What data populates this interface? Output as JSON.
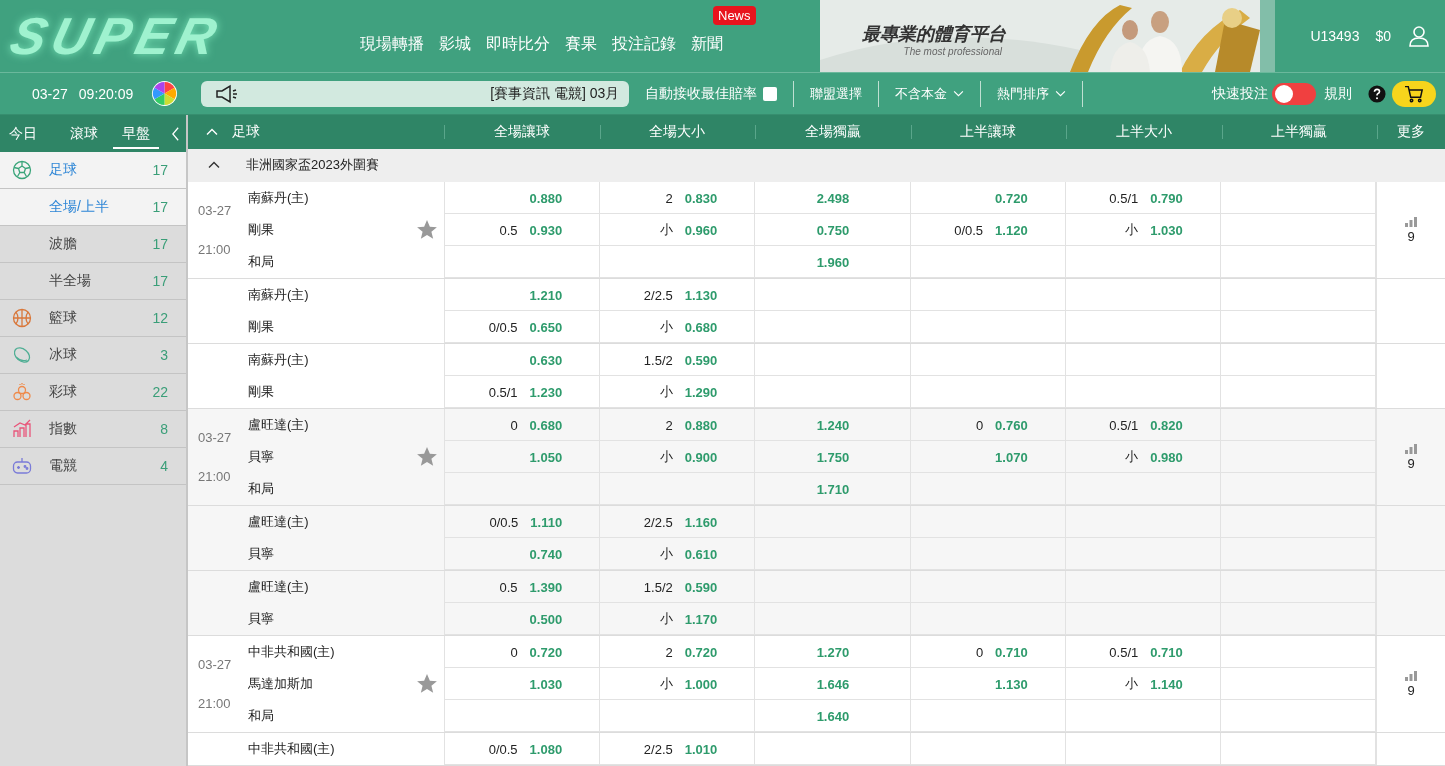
{
  "header": {
    "logo": "SUPER",
    "nav": [
      {
        "label": "現場轉播"
      },
      {
        "label": "影城"
      },
      {
        "label": "即時比分"
      },
      {
        "label": "賽果"
      },
      {
        "label": "投注記錄"
      },
      {
        "label": "新聞",
        "badge": "News"
      }
    ]
  },
  "banner": {
    "kind": "picture",
    "title": "最專業的體育平台",
    "subtitle": "The most professional"
  },
  "account": {
    "user": "U13493",
    "balance": "$0"
  },
  "toolbar": {
    "date": "03-27",
    "time": "09:20:09",
    "marquee": "[賽事資訊 電競] 03月",
    "auto_accept": {
      "label": "自動接收最佳賠率",
      "checked": false
    },
    "filters": [
      {
        "label": "聯盟選擇",
        "dropdown": false
      },
      {
        "label": "不含本金",
        "dropdown": true
      },
      {
        "label": "熱門排序",
        "dropdown": true
      }
    ],
    "quick_bet": {
      "label": "快速投注",
      "on": false
    },
    "rules": "規則"
  },
  "sidebar": {
    "tabs": [
      {
        "label": "今日",
        "selected": false
      },
      {
        "label": "滾球",
        "selected": false
      },
      {
        "label": "早盤",
        "selected": true
      }
    ],
    "items": [
      {
        "label": "足球",
        "count": "17",
        "selected": true,
        "children": [
          {
            "label": "全場/上半",
            "count": "17",
            "selected": true
          },
          {
            "label": "波膽",
            "count": "17",
            "selected": false
          },
          {
            "label": "半全場",
            "count": "17",
            "selected": false
          }
        ]
      },
      {
        "label": "籃球",
        "count": "12",
        "selected": false
      },
      {
        "label": "冰球",
        "count": "3",
        "selected": false
      },
      {
        "label": "彩球",
        "count": "22",
        "selected": false
      },
      {
        "label": "指數",
        "count": "8",
        "selected": false
      },
      {
        "label": "電競",
        "count": "4",
        "selected": false
      }
    ]
  },
  "table": {
    "sport": "足球",
    "expanded": true,
    "columns": [
      {
        "label": "全場讓球",
        "kind": "handicap"
      },
      {
        "label": "全場大小",
        "kind": "handicap"
      },
      {
        "label": "全場獨贏",
        "kind": "moneyline"
      },
      {
        "label": "上半讓球",
        "kind": "handicap"
      },
      {
        "label": "上半大小",
        "kind": "handicap"
      },
      {
        "label": "上半獨贏",
        "kind": "moneyline"
      }
    ],
    "more": "更多",
    "league": {
      "name": "非洲國家盃2023外圍賽",
      "expanded": true
    },
    "matches": [
      {
        "date": "03-27",
        "time": "21:00",
        "favorite": false,
        "more": "9",
        "rows": [
          {
            "team": "南蘇丹(主)",
            "cells": [
              {
                "odds": "0.880"
              },
              {
                "line": "2",
                "odds": "0.830"
              },
              {
                "odds": "2.498"
              },
              {
                "odds": "0.720"
              },
              {
                "line": "0.5/1",
                "odds": "0.790"
              },
              null
            ]
          },
          {
            "team": "剛果",
            "cells": [
              {
                "line": "0.5",
                "odds": "0.930"
              },
              {
                "line": "小",
                "odds": "0.960"
              },
              {
                "odds": "0.750"
              },
              {
                "line": "0/0.5",
                "odds": "1.120"
              },
              {
                "line": "小",
                "odds": "1.030"
              },
              null
            ]
          },
          {
            "team": "和局",
            "cells": [
              null,
              null,
              {
                "odds": "1.960"
              },
              null,
              null,
              null
            ]
          }
        ],
        "alt_lines": [
          {
            "rows": [
              {
                "team": "南蘇丹(主)",
                "cells": [
                  {
                    "odds": "1.210"
                  },
                  {
                    "line": "2/2.5",
                    "odds": "1.130"
                  }
                ]
              },
              {
                "team": "剛果",
                "cells": [
                  {
                    "line": "0/0.5",
                    "odds": "0.650"
                  },
                  {
                    "line": "小",
                    "odds": "0.680"
                  }
                ]
              }
            ]
          },
          {
            "rows": [
              {
                "team": "南蘇丹(主)",
                "cells": [
                  {
                    "odds": "0.630"
                  },
                  {
                    "line": "1.5/2",
                    "odds": "0.590"
                  }
                ]
              },
              {
                "team": "剛果",
                "cells": [
                  {
                    "line": "0.5/1",
                    "odds": "1.230"
                  },
                  {
                    "line": "小",
                    "odds": "1.290"
                  }
                ]
              }
            ]
          }
        ]
      },
      {
        "date": "03-27",
        "time": "21:00",
        "favorite": false,
        "more": "9",
        "rows": [
          {
            "team": "盧旺達(主)",
            "cells": [
              {
                "line": "0",
                "odds": "0.680"
              },
              {
                "line": "2",
                "odds": "0.880"
              },
              {
                "odds": "1.240"
              },
              {
                "line": "0",
                "odds": "0.760"
              },
              {
                "line": "0.5/1",
                "odds": "0.820"
              },
              null
            ]
          },
          {
            "team": "貝寧",
            "cells": [
              {
                "odds": "1.050"
              },
              {
                "line": "小",
                "odds": "0.900"
              },
              {
                "odds": "1.750"
              },
              {
                "odds": "1.070"
              },
              {
                "line": "小",
                "odds": "0.980"
              },
              null
            ]
          },
          {
            "team": "和局",
            "cells": [
              null,
              null,
              {
                "odds": "1.710"
              },
              null,
              null,
              null
            ]
          }
        ],
        "alt_lines": [
          {
            "rows": [
              {
                "team": "盧旺達(主)",
                "cells": [
                  {
                    "line": "0/0.5",
                    "odds": "1.110"
                  },
                  {
                    "line": "2/2.5",
                    "odds": "1.160"
                  }
                ]
              },
              {
                "team": "貝寧",
                "cells": [
                  {
                    "odds": "0.740"
                  },
                  {
                    "line": "小",
                    "odds": "0.610"
                  }
                ]
              }
            ]
          },
          {
            "rows": [
              {
                "team": "盧旺達(主)",
                "cells": [
                  {
                    "line": "0.5",
                    "odds": "1.390"
                  },
                  {
                    "line": "1.5/2",
                    "odds": "0.590"
                  }
                ]
              },
              {
                "team": "貝寧",
                "cells": [
                  {
                    "odds": "0.500"
                  },
                  {
                    "line": "小",
                    "odds": "1.170"
                  }
                ]
              }
            ]
          }
        ]
      },
      {
        "date": "03-27",
        "time": "21:00",
        "favorite": false,
        "more": "9",
        "rows": [
          {
            "team": "中非共和國(主)",
            "cells": [
              {
                "line": "0",
                "odds": "0.720"
              },
              {
                "line": "2",
                "odds": "0.720"
              },
              {
                "odds": "1.270"
              },
              {
                "line": "0",
                "odds": "0.710"
              },
              {
                "line": "0.5/1",
                "odds": "0.710"
              },
              null
            ]
          },
          {
            "team": "馬達加斯加",
            "cells": [
              {
                "odds": "1.030"
              },
              {
                "line": "小",
                "odds": "1.000"
              },
              {
                "odds": "1.646"
              },
              {
                "odds": "1.130"
              },
              {
                "line": "小",
                "odds": "1.140"
              },
              null
            ]
          },
          {
            "team": "和局",
            "cells": [
              null,
              null,
              {
                "odds": "1.640"
              },
              null,
              null,
              null
            ]
          }
        ],
        "alt_lines": [
          {
            "rows": [
              {
                "team": "中非共和國(主)",
                "cells": [
                  {
                    "line": "0/0.5",
                    "odds": "1.080"
                  },
                  {
                    "line": "2/2.5",
                    "odds": "1.010"
                  }
                ]
              }
            ]
          }
        ]
      }
    ]
  }
}
